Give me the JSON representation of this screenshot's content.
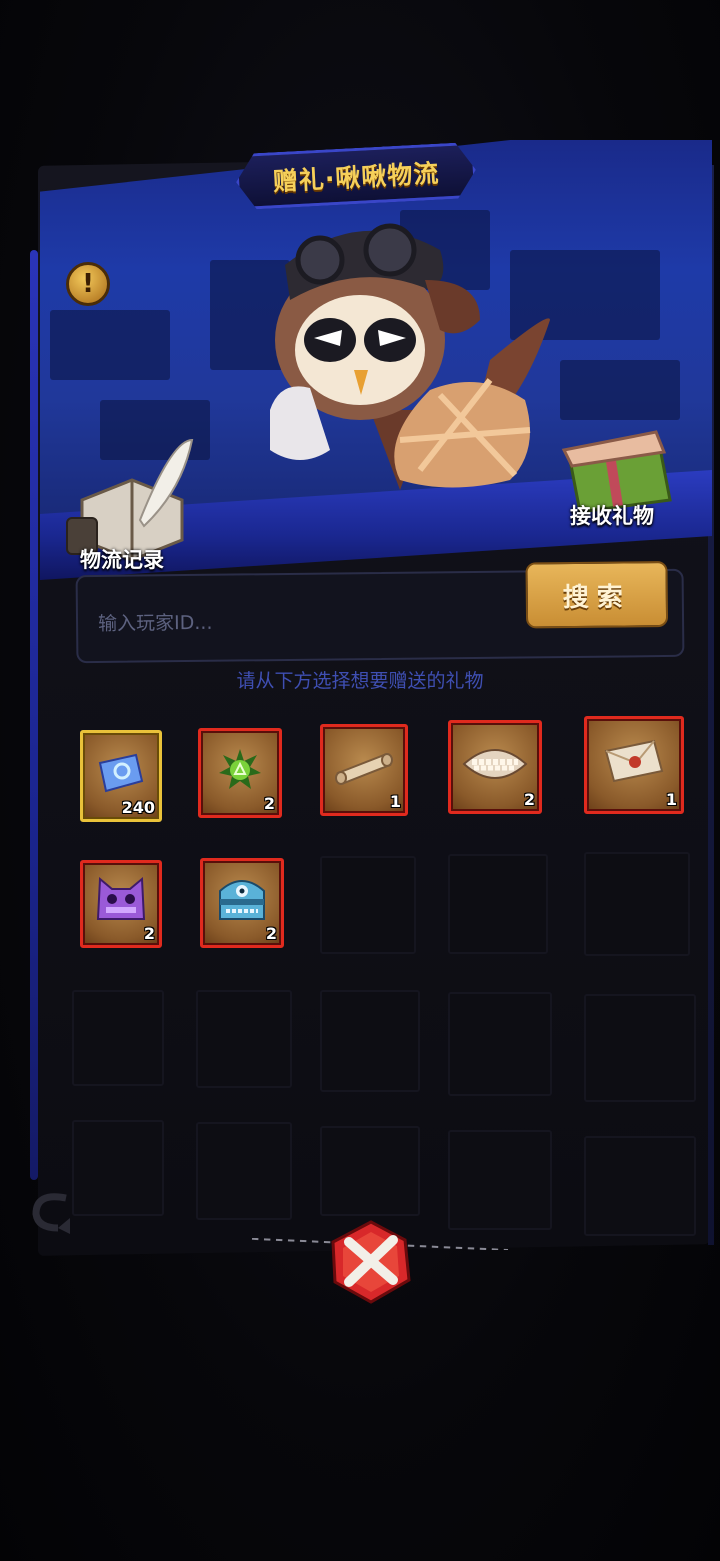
{
  "header": {
    "title": "赠礼·啾啾物流"
  },
  "actions": {
    "record_label": "物流记录",
    "receive_label": "接收礼物"
  },
  "search": {
    "placeholder": "输入玩家ID...",
    "button_label": "搜索"
  },
  "hint_text": "请从下方选择想要赠送的礼物",
  "items": [
    {
      "icon": "ticket-icon",
      "count": "240",
      "rarity": "gold"
    },
    {
      "icon": "green-orb-icon",
      "count": "2",
      "rarity": "red"
    },
    {
      "icon": "scroll-icon",
      "count": "1",
      "rarity": "red"
    },
    {
      "icon": "teeth-icon",
      "count": "2",
      "rarity": "red"
    },
    {
      "icon": "letter-icon",
      "count": "1",
      "rarity": "red"
    },
    {
      "icon": "purple-monster-icon",
      "count": "2",
      "rarity": "red"
    },
    {
      "icon": "blue-chest-monster-icon",
      "count": "2",
      "rarity": "red"
    }
  ],
  "colors": {
    "title_gold": "#f6d05a",
    "search_button": "#e8b65a",
    "hint_blue": "#3f4fb2",
    "rare_border": "#e02a1e",
    "gold_border": "#e9c23a",
    "close_red": "#d8282a"
  }
}
